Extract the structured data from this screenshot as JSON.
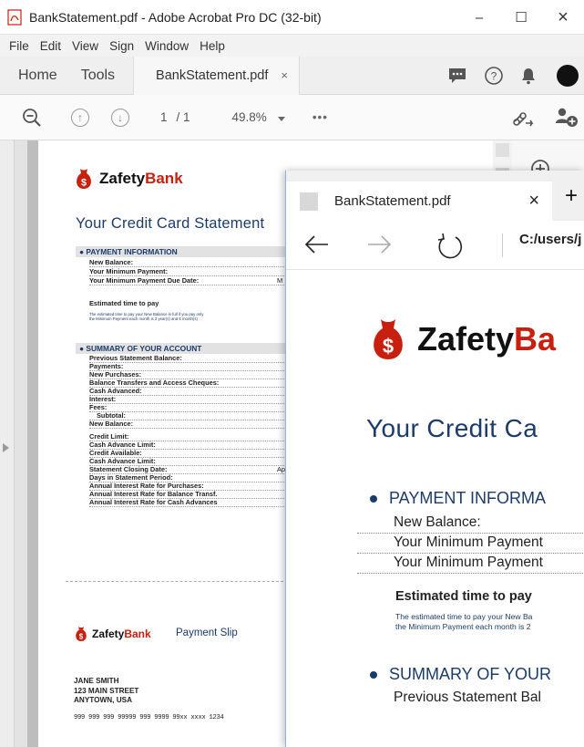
{
  "acrobat": {
    "window_title": "BankStatement.pdf - Adobe Acrobat Pro DC (32-bit)",
    "window_controls": {
      "minimize": "–",
      "maximize": "☐",
      "close": "×"
    },
    "menu": [
      "File",
      "Edit",
      "View",
      "Sign",
      "Window",
      "Help"
    ],
    "tabs": {
      "home": "Home",
      "tools": "Tools",
      "document": "BankStatement.pdf",
      "close": "×"
    },
    "toolbar": {
      "page_current": "1",
      "page_total": "/ 1",
      "zoom": "49.8%",
      "more": "•••"
    }
  },
  "pdf_page": {
    "brand_first": "Zafety",
    "brand_second": "Bank",
    "heading": "Your Credit Card Statement",
    "payment_section": "●  PAYMENT INFORMATION",
    "payment_rows": [
      "New Balance:",
      "Your Minimum Payment:",
      "Your Minimum Payment Due Date:"
    ],
    "payment_due_value_partial": "M",
    "estimated_title": "Estimated time to pay",
    "estimated_text_1": "The estimated time to pay your New Balance in full if you pay only",
    "estimated_text_2": "the Minimum Payment each month is 2 year(s) and 6 month(s)",
    "summary_section": "●  SUMMARY OF YOUR ACCOUNT",
    "summary_rows": [
      "Previous Statement Balance:",
      "Payments:",
      "New Purchases:",
      "Balance Transfers and Access Cheques:",
      "Cash Advanced:",
      "Interest:",
      "Fees:",
      "Subtotal:",
      "New Balance:"
    ],
    "limit_rows": [
      "Credit Limit:",
      "Cash Advance Limit:",
      "Credit Available:",
      "Cash Advance Limit:",
      "Statement Closing Date:",
      "Days in Statement Period:",
      "Annual Interest Rate for Purchases:",
      "Annual Interest Rate for Balance Transf.",
      "Annual Interest Rate for Cash Advances"
    ],
    "closing_date_value_partial": "Ap",
    "slip_brand_first": "Zafety",
    "slip_brand_second": "Bank",
    "slip_label": "Payment Slip",
    "address": [
      "JANE SMITH",
      "123 MAIN STREET",
      "ANYTOWN, USA"
    ],
    "account_line": "999 999 999   99999  999   9999 99xx xxxx 1234"
  },
  "edge": {
    "tab_title": "BankStatement.pdf",
    "tab_close": "×",
    "new_tab": "+",
    "address": "C:/users/j",
    "brand_first": "Zafety",
    "brand_second": "Ba",
    "heading": "Your Credit Ca",
    "payment_section": "PAYMENT INFORMA",
    "rows": [
      "New Balance:",
      "Your Minimum Payment",
      "Your Minimum Payment"
    ],
    "estimated_title": "Estimated time to pay",
    "estimated_text_1": "The estimated time to pay your New Ba",
    "estimated_text_2": "the Minimum Payment each month is 2",
    "summary_section": "SUMMARY OF YOUR",
    "last_row": "Previous Statement Bal"
  },
  "colors": {
    "brand_red": "#c8200e",
    "navy": "#1b3b6b"
  }
}
